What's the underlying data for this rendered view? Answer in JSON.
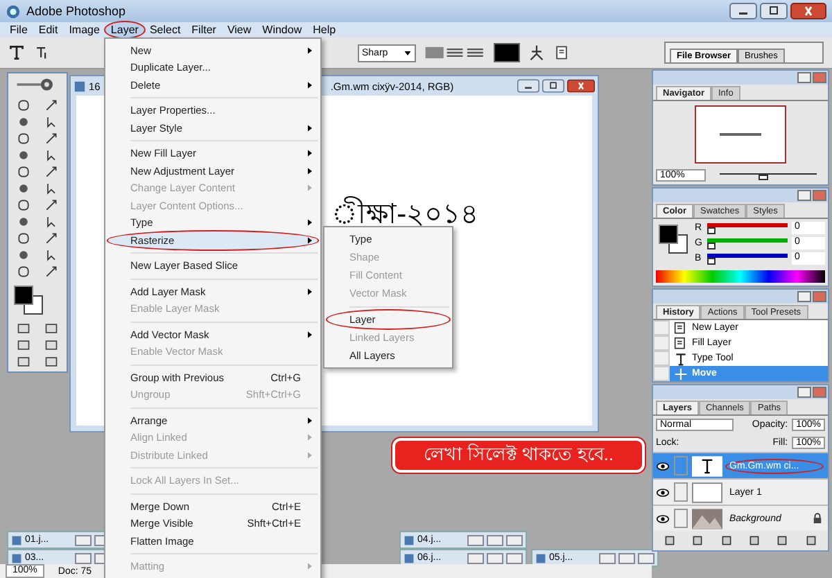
{
  "window": {
    "title": "Adobe Photoshop"
  },
  "menu_bar": [
    {
      "label": "File",
      "selected": false,
      "circled": false
    },
    {
      "label": "Edit",
      "selected": false,
      "circled": false
    },
    {
      "label": "Image",
      "selected": false,
      "circled": false
    },
    {
      "label": "Layer",
      "selected": true,
      "circled": true
    },
    {
      "label": "Select",
      "selected": false,
      "circled": false
    },
    {
      "label": "Filter",
      "selected": false,
      "circled": false
    },
    {
      "label": "View",
      "selected": false,
      "circled": false
    },
    {
      "label": "Window",
      "selected": false,
      "circled": false
    },
    {
      "label": "Help",
      "selected": false,
      "circled": false
    }
  ],
  "options_bar": {
    "antialias": "Sharp",
    "palette_tabs": [
      {
        "label": "File Browser",
        "selected": true
      },
      {
        "label": "Brushes",
        "selected": false
      }
    ]
  },
  "document": {
    "title_start": "16",
    "title_end": ".Gm.wm cixÿv-2014, RGB)",
    "canvas_text": "ীক্ষা-২০১৪"
  },
  "layer_menu": [
    {
      "kind": "item",
      "label": "New",
      "submenu": true,
      "disabled": false,
      "highlighted": false,
      "circled": false
    },
    {
      "kind": "item",
      "label": "Duplicate Layer...",
      "submenu": false,
      "disabled": false,
      "highlighted": false,
      "circled": false
    },
    {
      "kind": "item",
      "label": "Delete",
      "submenu": true,
      "disabled": false,
      "highlighted": false,
      "circled": false
    },
    {
      "kind": "separator"
    },
    {
      "kind": "item",
      "label": "Layer Properties...",
      "submenu": false,
      "disabled": false,
      "highlighted": false,
      "circled": false
    },
    {
      "kind": "item",
      "label": "Layer Style",
      "submenu": true,
      "disabled": false,
      "highlighted": false,
      "circled": false
    },
    {
      "kind": "separator"
    },
    {
      "kind": "item",
      "label": "New Fill Layer",
      "submenu": true,
      "disabled": false,
      "highlighted": false,
      "circled": false
    },
    {
      "kind": "item",
      "label": "New Adjustment Layer",
      "submenu": true,
      "disabled": false,
      "highlighted": false,
      "circled": false
    },
    {
      "kind": "item",
      "label": "Change Layer Content",
      "submenu": true,
      "disabled": true,
      "highlighted": false,
      "circled": false
    },
    {
      "kind": "item",
      "label": "Layer Content Options...",
      "submenu": false,
      "disabled": true,
      "highlighted": false,
      "circled": false
    },
    {
      "kind": "item",
      "label": "Type",
      "submenu": true,
      "disabled": false,
      "highlighted": false,
      "circled": false
    },
    {
      "kind": "item",
      "label": "Rasterize",
      "submenu": true,
      "disabled": false,
      "highlighted": true,
      "circled": true
    },
    {
      "kind": "separator"
    },
    {
      "kind": "item",
      "label": "New Layer Based Slice",
      "submenu": false,
      "disabled": false,
      "highlighted": false,
      "circled": false
    },
    {
      "kind": "separator"
    },
    {
      "kind": "item",
      "label": "Add Layer Mask",
      "submenu": true,
      "disabled": false,
      "highlighted": false,
      "circled": false
    },
    {
      "kind": "item",
      "label": "Enable Layer Mask",
      "submenu": false,
      "disabled": true,
      "highlighted": false,
      "circled": false
    },
    {
      "kind": "separator"
    },
    {
      "kind": "item",
      "label": "Add Vector Mask",
      "submenu": true,
      "disabled": false,
      "highlighted": false,
      "circled": false
    },
    {
      "kind": "item",
      "label": "Enable Vector Mask",
      "submenu": false,
      "disabled": true,
      "highlighted": false,
      "circled": false
    },
    {
      "kind": "separator"
    },
    {
      "kind": "item",
      "label": "Group with Previous",
      "shortcut": "Ctrl+G",
      "submenu": false,
      "disabled": false,
      "highlighted": false,
      "circled": false
    },
    {
      "kind": "item",
      "label": "Ungroup",
      "shortcut": "Shft+Ctrl+G",
      "submenu": false,
      "disabled": true,
      "highlighted": false,
      "circled": false
    },
    {
      "kind": "separator"
    },
    {
      "kind": "item",
      "label": "Arrange",
      "submenu": true,
      "disabled": false,
      "highlighted": false,
      "circled": false
    },
    {
      "kind": "item",
      "label": "Align Linked",
      "submenu": true,
      "disabled": true,
      "highlighted": false,
      "circled": false
    },
    {
      "kind": "item",
      "label": "Distribute Linked",
      "submenu": true,
      "disabled": true,
      "highlighted": false,
      "circled": false
    },
    {
      "kind": "separator"
    },
    {
      "kind": "item",
      "label": "Lock All Layers In Set...",
      "submenu": false,
      "disabled": true,
      "highlighted": false,
      "circled": false
    },
    {
      "kind": "separator"
    },
    {
      "kind": "item",
      "label": "Merge Down",
      "shortcut": "Ctrl+E",
      "submenu": false,
      "disabled": false,
      "highlighted": false,
      "circled": false
    },
    {
      "kind": "item",
      "label": "Merge Visible",
      "shortcut": "Shft+Ctrl+E",
      "submenu": false,
      "disabled": false,
      "highlighted": false,
      "circled": false
    },
    {
      "kind": "item",
      "label": "Flatten Image",
      "submenu": false,
      "disabled": false,
      "highlighted": false,
      "circled": false
    },
    {
      "kind": "separator"
    },
    {
      "kind": "item",
      "label": "Matting",
      "submenu": true,
      "disabled": true,
      "highlighted": false,
      "circled": false
    }
  ],
  "rasterize_submenu": [
    {
      "kind": "item",
      "label": "Type",
      "disabled": false,
      "circled": false
    },
    {
      "kind": "item",
      "label": "Shape",
      "disabled": true,
      "circled": false
    },
    {
      "kind": "item",
      "label": "Fill Content",
      "disabled": true,
      "circled": false
    },
    {
      "kind": "item",
      "label": "Vector Mask",
      "disabled": true,
      "circled": false
    },
    {
      "kind": "separator"
    },
    {
      "kind": "item",
      "label": "Layer",
      "disabled": false,
      "circled": true
    },
    {
      "kind": "item",
      "label": "Linked Layers",
      "disabled": true,
      "circled": false
    },
    {
      "kind": "item",
      "label": "All Layers",
      "disabled": false,
      "circled": false
    }
  ],
  "navigator": {
    "tabs": [
      {
        "label": "Navigator",
        "selected": true
      },
      {
        "label": "Info",
        "selected": false
      }
    ],
    "zoom": "100%",
    "level": 0.45
  },
  "color": {
    "tabs": [
      {
        "label": "Color",
        "selected": true
      },
      {
        "label": "Swatches",
        "selected": false
      },
      {
        "label": "Styles",
        "selected": false
      }
    ],
    "channels": [
      {
        "label": "R",
        "value": "0",
        "level": 0,
        "color": "#d00000"
      },
      {
        "label": "G",
        "value": "0",
        "level": 0,
        "color": "#00b000"
      },
      {
        "label": "B",
        "value": "0",
        "level": 0,
        "color": "#0000c0"
      }
    ]
  },
  "history": {
    "tabs": [
      {
        "label": "History",
        "selected": true
      },
      {
        "label": "Actions",
        "selected": false
      },
      {
        "label": "Tool Presets",
        "selected": false
      }
    ],
    "items": [
      {
        "label": "New Layer",
        "kind": "layer",
        "selected": false
      },
      {
        "label": "Fill Layer",
        "kind": "layer",
        "selected": false
      },
      {
        "label": "Type Tool",
        "kind": "type",
        "selected": false
      },
      {
        "label": "Move",
        "kind": "move",
        "selected": true
      }
    ]
  },
  "layers": {
    "tabs": [
      {
        "label": "Layers",
        "selected": true
      },
      {
        "label": "Channels",
        "selected": false
      },
      {
        "label": "Paths",
        "selected": false
      }
    ],
    "blend_mode": "Normal",
    "opacity_label": "Opacity:",
    "opacity": "100%",
    "lock_label": "Lock:",
    "fill_label": "Fill:",
    "fill": "100%",
    "items": [
      {
        "name": "Gm.Gm.wm ci...",
        "kind": "text",
        "selected": true,
        "circled": true,
        "visible": true,
        "locked": false
      },
      {
        "name": "Layer 1",
        "kind": "plain",
        "selected": false,
        "circled": false,
        "visible": true,
        "locked": false
      },
      {
        "name": "Background",
        "kind": "background",
        "selected": false,
        "circled": false,
        "visible": true,
        "locked": true
      }
    ]
  },
  "minimized_documents": [
    {
      "label": "01.j..."
    },
    {
      "label": "04.j..."
    },
    {
      "label": "03..."
    },
    {
      "label": "06.j..."
    },
    {
      "label": "05.j..."
    }
  ],
  "status_bar": {
    "zoom": "100%",
    "doc": "Doc: 75"
  },
  "callout": {
    "text": "লেখা সিলেক্ট থাকতে হবে.."
  }
}
